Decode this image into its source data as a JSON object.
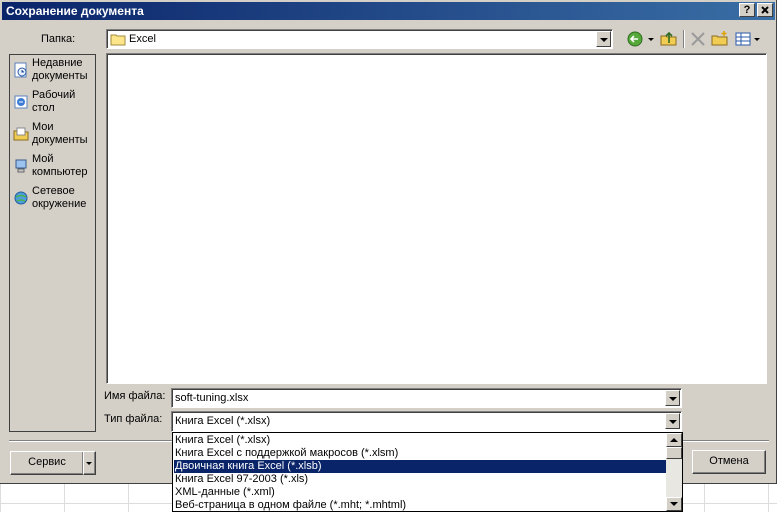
{
  "window": {
    "title": "Сохранение документа",
    "help_button": "?",
    "close_button": "X"
  },
  "lookin": {
    "label": "Папка:",
    "value": "Excel"
  },
  "toolbar": {
    "icons": [
      "back-icon",
      "up-folder-icon",
      "delete-icon",
      "new-folder-icon",
      "views-icon"
    ]
  },
  "places": [
    {
      "line1": "Недавние",
      "line2": "документы",
      "icon": "recent-documents-icon"
    },
    {
      "line1": "Рабочий",
      "line2": "стол",
      "icon": "desktop-icon"
    },
    {
      "line1": "Мои",
      "line2": "документы",
      "icon": "my-documents-icon"
    },
    {
      "line1": "Мой",
      "line2": "компьютер",
      "icon": "my-computer-icon"
    },
    {
      "line1": "Сетевое",
      "line2": "окружение",
      "icon": "network-icon"
    }
  ],
  "filename": {
    "label": "Имя файла:",
    "value": "soft-tuning.xlsx"
  },
  "filetype": {
    "label": "Тип файла:",
    "value": "Книга Excel (*.xlsx)",
    "options": [
      "Книга Excel (*.xlsx)",
      "Книга Excel с поддержкой макросов (*.xlsm)",
      "Двоичная книга Excel (*.xlsb)",
      "Книга Excel 97-2003 (*.xls)",
      "XML-данные (*.xml)",
      "Веб-страница в одном файле (*.mht; *.mhtml)"
    ],
    "selected_option": "Двоичная книга Excel (*.xlsb)"
  },
  "buttons": {
    "service": "Сервис",
    "cancel": "Отмена"
  },
  "colors": {
    "titlebar": "#0a246a",
    "selection": "#0a246a",
    "dialog_bg": "#d4d0c8"
  }
}
